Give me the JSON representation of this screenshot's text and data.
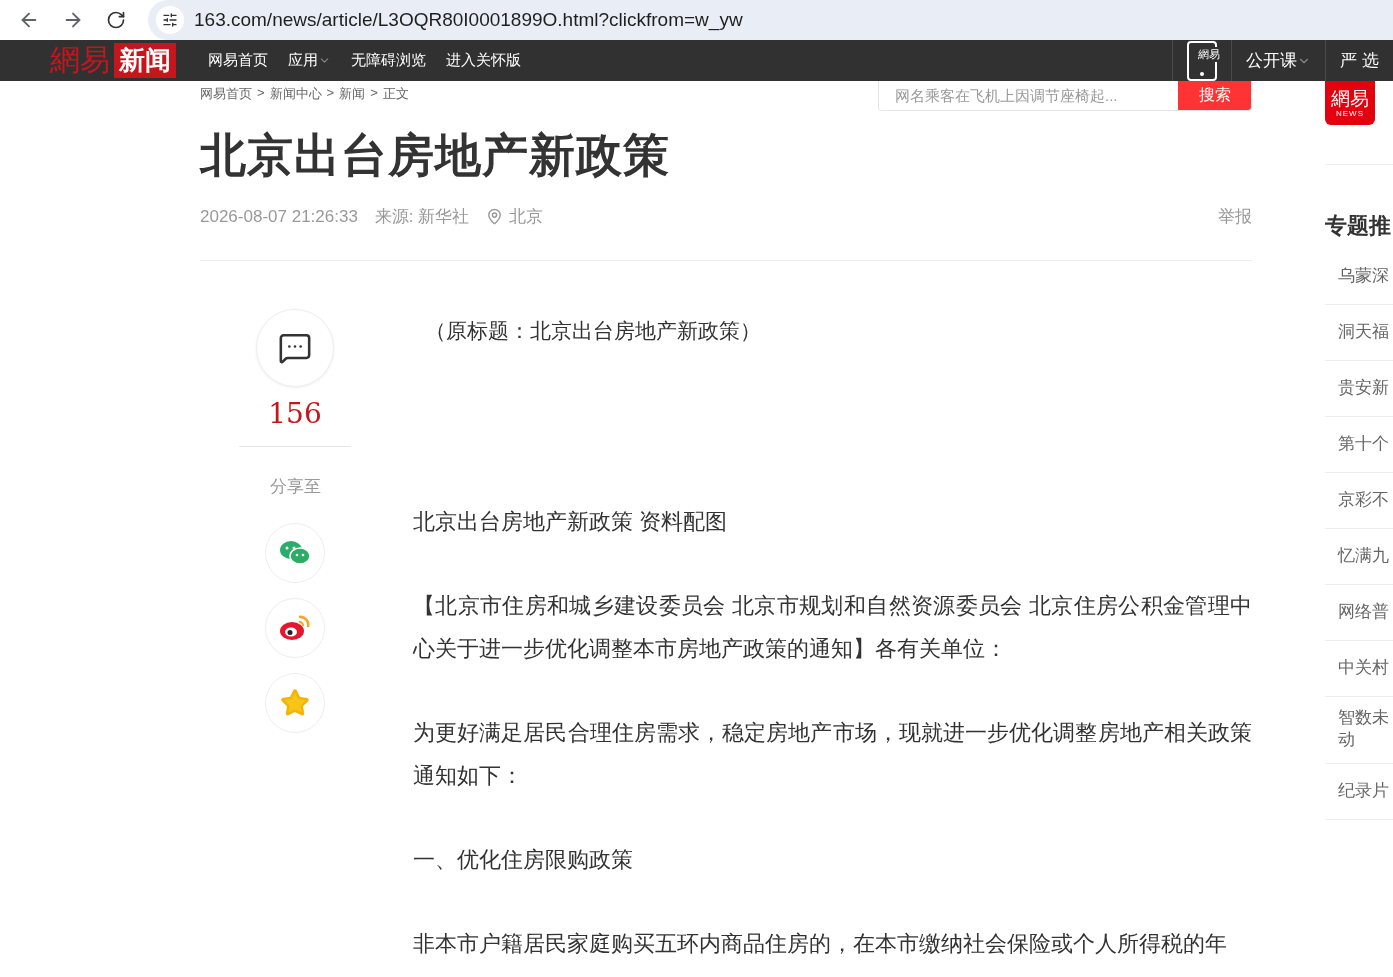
{
  "browser": {
    "url": "163.com/news/article/L3OQR80I0001899O.html?clickfrom=w_yw"
  },
  "nav": {
    "logo": {
      "brand": "網易",
      "product": "新闻"
    },
    "links": [
      {
        "label": "网易首页",
        "dropdown": false
      },
      {
        "label": "应用",
        "dropdown": true
      },
      {
        "label": "无障碍浏览",
        "dropdown": false
      },
      {
        "label": "进入关怀版",
        "dropdown": false
      }
    ],
    "right": [
      {
        "kind": "app",
        "label": "網易",
        "dropdown": false
      },
      {
        "kind": "link",
        "label": "公开课",
        "dropdown": true
      },
      {
        "kind": "link",
        "label": "严 选",
        "dropdown": false
      }
    ]
  },
  "breadcrumb": {
    "separator": ">",
    "items": [
      "网易首页",
      "新闻中心",
      "新闻",
      "正文"
    ]
  },
  "search": {
    "placeholder": "网名乘客在飞机上因调节座椅起...",
    "button": "搜索"
  },
  "article": {
    "title": "北京出台房地产新政策",
    "time": "2026-08-07 21:26:33",
    "source": "来源: 新华社",
    "location": "北京",
    "report": "举报",
    "comment_count": "156",
    "share_label": "分享至",
    "share": [
      {
        "kind": "wechat"
      },
      {
        "kind": "weibo"
      },
      {
        "kind": "favorite"
      }
    ],
    "paragraphs": [
      {
        "kind": "lead",
        "text": "（原标题：北京出台房地产新政策）"
      },
      {
        "kind": "caption",
        "text": "北京出台房地产新政策 资料配图"
      },
      {
        "kind": "text",
        "text": "【北京市住房和城乡建设委员会 北京市规划和自然资源委员会 北京住房公积金管理中心关于进一步优化调整本市房地产政策的通知】各有关单位："
      },
      {
        "kind": "text",
        "text": "为更好满足居民合理住房需求，稳定房地产市场，现就进一步优化调整房地产相关政策通知如下："
      },
      {
        "kind": "text",
        "text": "一、优化住房限购政策"
      },
      {
        "kind": "text",
        "text": "非本市户籍居民家庭购买五环内商品住房的，在本市缴纳社会保险或个人所得税的年"
      }
    ]
  },
  "sidebar": {
    "logo": {
      "brand": "網易",
      "sub": "NEWS"
    },
    "heading": "专题推",
    "items": [
      "乌蒙深",
      "洞天福",
      "贵安新",
      "第十个",
      "京彩不",
      "忆满九",
      "网络普",
      "中关村",
      "智数未动",
      "纪录片"
    ]
  }
}
